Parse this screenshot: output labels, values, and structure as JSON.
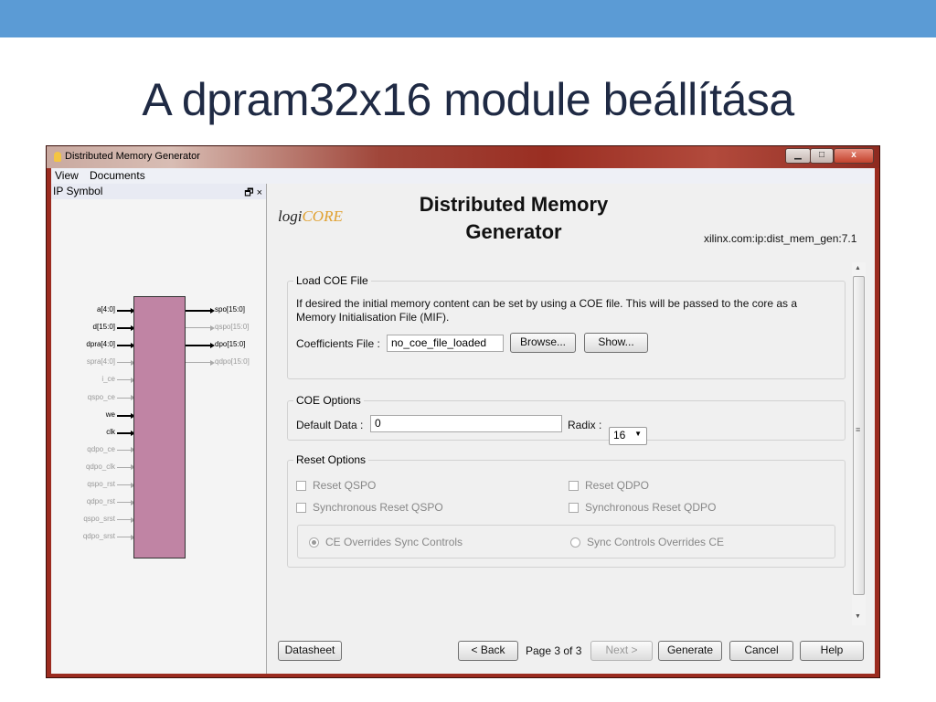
{
  "slide": {
    "title": "A dpram32x16 module beállítása"
  },
  "window": {
    "title": "Distributed Memory Generator",
    "controls": {
      "minimize": "▁",
      "maximize": "□",
      "close": "x"
    },
    "menu": [
      "View",
      "Documents"
    ]
  },
  "ip_panel": {
    "header": "IP Symbol",
    "header_controls": "🗗 ×",
    "left_pins": [
      {
        "label": "a[4:0]",
        "active": true
      },
      {
        "label": "d[15:0]",
        "active": true
      },
      {
        "label": "dpra[4:0]",
        "active": true
      },
      {
        "label": "spra[4:0]",
        "active": false
      },
      {
        "label": "i_ce",
        "active": false
      },
      {
        "label": "qspo_ce",
        "active": false
      },
      {
        "label": "we",
        "active": true
      },
      {
        "label": "clk",
        "active": true
      },
      {
        "label": "qdpo_ce",
        "active": false
      },
      {
        "label": "qdpo_clk",
        "active": false
      },
      {
        "label": "qspo_rst",
        "active": false
      },
      {
        "label": "qdpo_rst",
        "active": false
      },
      {
        "label": "qspo_srst",
        "active": false
      },
      {
        "label": "qdpo_srst",
        "active": false
      }
    ],
    "right_pins": [
      {
        "label": "spo[15:0]",
        "active": true
      },
      {
        "label": "qspo[15:0]",
        "active": false
      },
      {
        "label": "dpo[15:0]",
        "active": true
      },
      {
        "label": "qdpo[15:0]",
        "active": false
      }
    ]
  },
  "main": {
    "logo_prefix": "logi",
    "logo_core": "CORE",
    "heading_line1": "Distributed Memory",
    "heading_line2": "Generator",
    "ip_id": "xilinx.com:ip:dist_mem_gen:7.1",
    "load_coe": {
      "title": "Load COE File",
      "description_line1": "If desired the initial memory content can be set by using a COE file.  This will be passed to the core as a",
      "description_line2": "Memory Initialisation File (MIF).",
      "coeff_label": "Coefficients File :",
      "coeff_value": "no_coe_file_loaded",
      "browse": "Browse...",
      "show": "Show..."
    },
    "coe_options": {
      "title": "COE Options",
      "default_data_label": "Default Data :",
      "default_data_value": "0",
      "radix_label": "Radix :",
      "radix_value": "16"
    },
    "reset_options": {
      "title": "Reset Options",
      "reset_qspo": "Reset QSPO",
      "reset_qdpo": "Reset QDPO",
      "sync_reset_qspo": "Synchronous Reset QSPO",
      "sync_reset_qdpo": "Synchronous Reset QDPO",
      "ce_overrides": "CE Overrides Sync Controls",
      "sync_overrides": "Sync Controls Overrides CE"
    },
    "footer": {
      "datasheet": "Datasheet",
      "back": "< Back",
      "page": "Page 3 of 3",
      "next": "Next >",
      "generate": "Generate",
      "cancel": "Cancel",
      "help": "Help"
    },
    "scroll": {
      "up": "▲",
      "down": "▼",
      "grip": "≡"
    }
  }
}
